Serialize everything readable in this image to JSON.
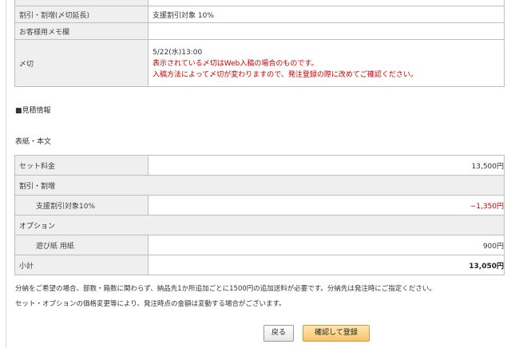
{
  "top_table": {
    "rows": [
      {
        "label": "割引・割増(〆切延長)",
        "value": "支援割引対象 10%"
      },
      {
        "label": "お客様用メモ欄",
        "value": ""
      },
      {
        "label": "〆切",
        "date": "5/22(水)13:00",
        "note1": "表示されている〆切はWeb入稿の場合のものです。",
        "note2": "入稿方法によって〆切が変わりますので、発注登録の際に改めてご確認ください。"
      }
    ]
  },
  "estimate": {
    "heading": "■見積情報",
    "subheading": "表紙・本文",
    "rows": [
      {
        "label": "セット料金",
        "value": "13,500円"
      },
      {
        "label": "割引・割増",
        "value": ""
      },
      {
        "label": "支援割引対象10%",
        "value": "−1,350円"
      },
      {
        "label": "オプション",
        "value": ""
      },
      {
        "label": "遊び紙 用紙",
        "value": "900円"
      },
      {
        "label": "小計",
        "value": "13,050円"
      }
    ]
  },
  "notes": [
    "分納をご希望の場合、部数・箱数に関わらず、納品先1か所追加ごとに1500円の追加送料が必要です。分納先は発注時にご指定ください。",
    "セット・オプションの価格変更等により、発注時点の金額は変動する場合がございます。"
  ],
  "buttons": {
    "back": "戻る",
    "confirm": "確認して登録"
  },
  "colors": {
    "label_bg": "#efefef",
    "border": "#bfbfbf",
    "red": "#cc0000",
    "confirm_bg": "#f6c46b"
  }
}
